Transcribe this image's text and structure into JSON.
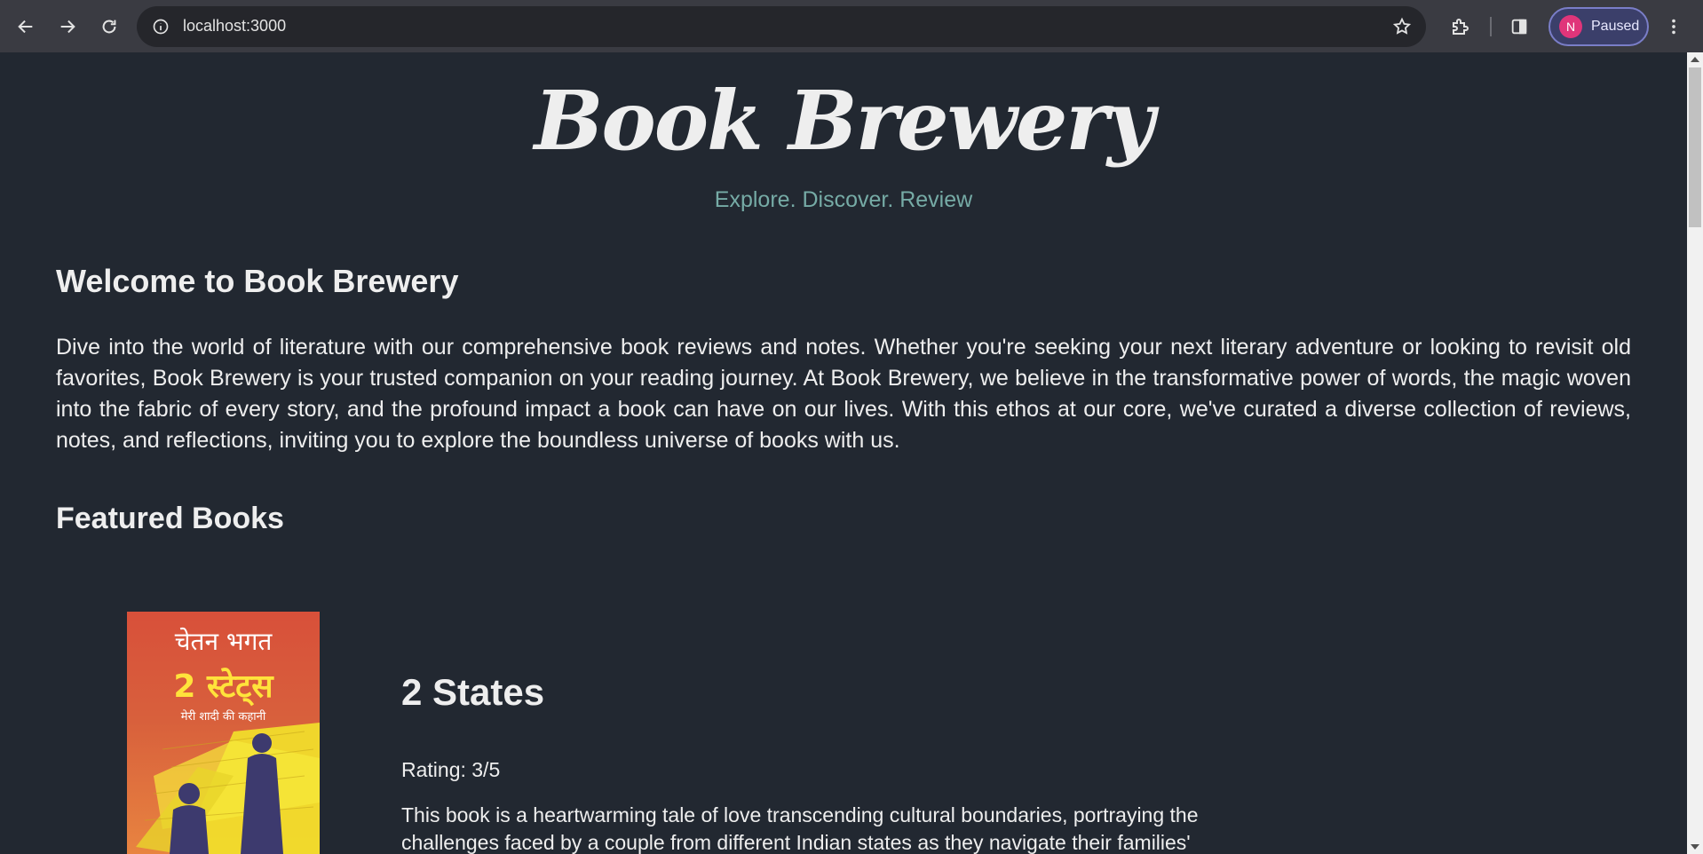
{
  "browser": {
    "url": "localhost:3000",
    "profile_initial": "N",
    "profile_status": "Paused"
  },
  "site": {
    "title": "Book Brewery",
    "tagline": "Explore. Discover. Review"
  },
  "welcome": {
    "heading": "Welcome to Book Brewery",
    "body": "Dive into the world of literature with our comprehensive book reviews and notes. Whether you're seeking your next literary adventure or looking to revisit old favorites, Book Brewery is your trusted companion on your reading journey. At Book Brewery, we believe in the transformative power of words, the magic woven into the fabric of every story, and the profound impact a book can have on our lives. With this ethos at our core, we've curated a diverse collection of reviews, notes, and reflections, inviting you to explore the boundless universe of books with us."
  },
  "featured": {
    "heading": "Featured Books",
    "books": [
      {
        "title": "2 States",
        "rating": "Rating: 3/5",
        "description": "This book is a heartwarming tale of love transcending cultural boundaries, portraying the challenges faced by a couple from different Indian states as they navigate their families'",
        "cover": {
          "author": "चेतन भगत",
          "title": "2 स्टेट्स",
          "subtitle": "मेरी शादी की कहानी"
        }
      }
    ]
  },
  "colors": {
    "page_bg": "#222831",
    "text": "#eeeeee",
    "tagline": "#76aba6",
    "chrome_bg": "#3a3b42",
    "omnibox_bg": "#25262b",
    "avatar_bg": "#e0357a"
  }
}
